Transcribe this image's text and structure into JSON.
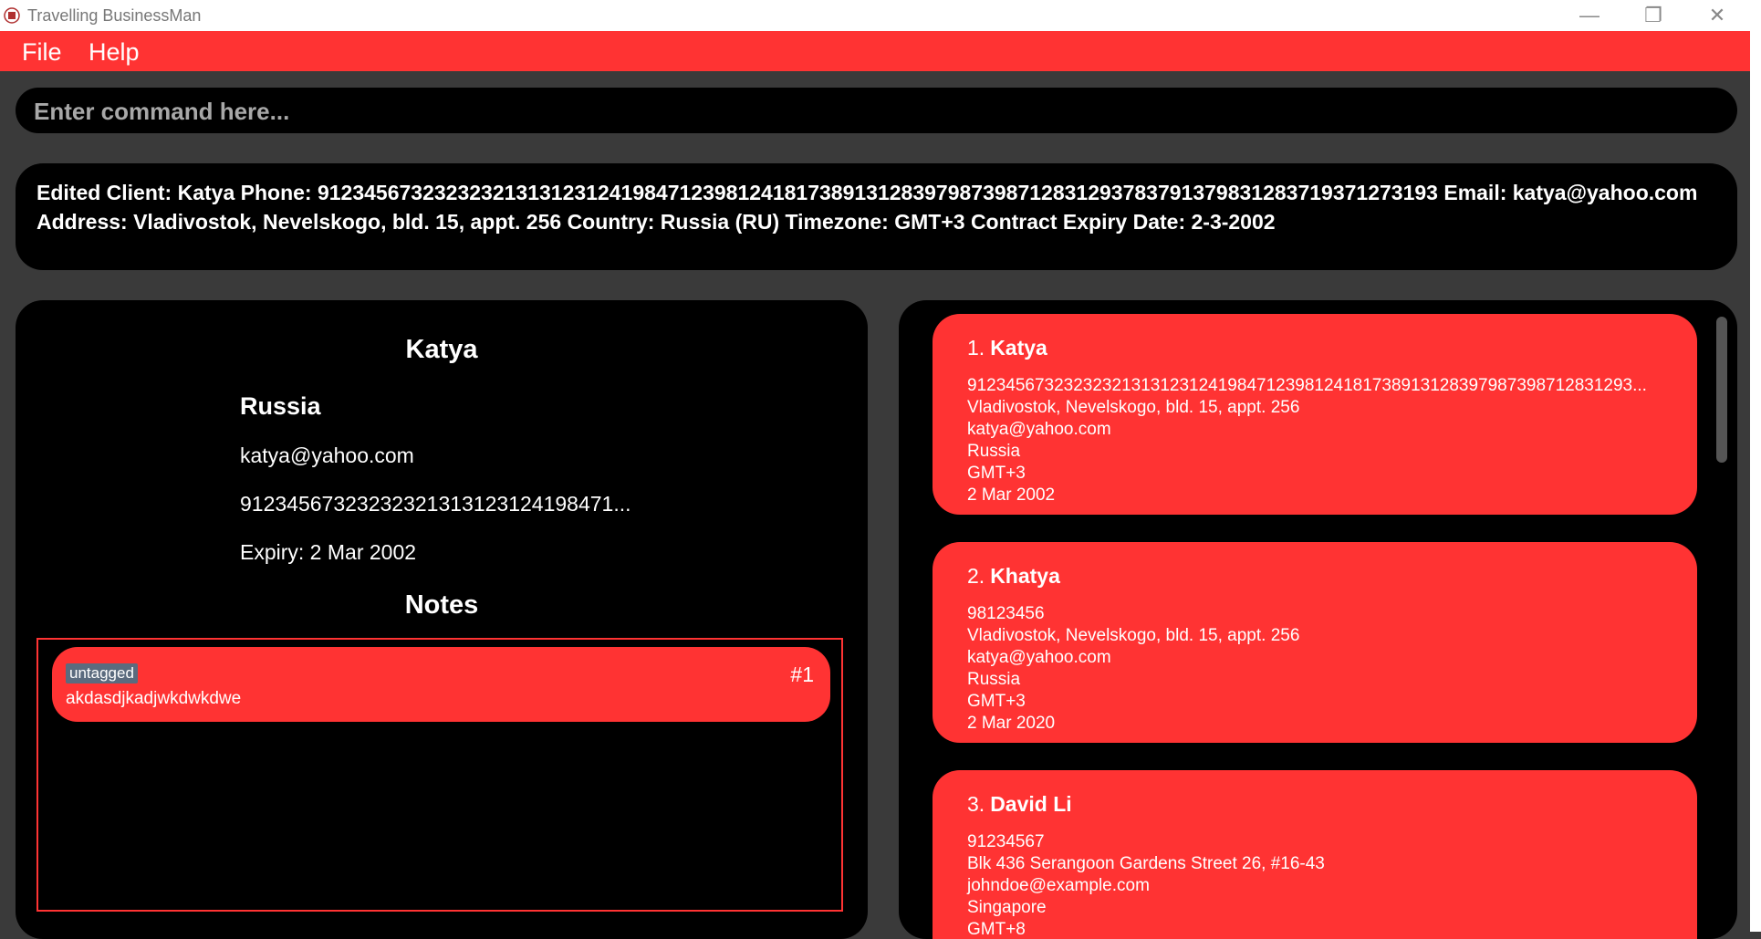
{
  "window": {
    "title": "Travelling BusinessMan",
    "minimize_glyph": "—",
    "maximize_glyph": "❐",
    "close_glyph": "✕"
  },
  "menu": {
    "file": "File",
    "help": "Help"
  },
  "command": {
    "placeholder": "Enter command here...",
    "value": ""
  },
  "result": {
    "text": "Edited Client: Katya Phone: 912345673232323213131231241984712398124181738913128397987398712831293783791379831283719371273193 Email: katya@yahoo.com Address: Vladivostok, Nevelskogo, bld. 15, appt. 256 Country: Russia (RU) Timezone: GMT+3 Contract Expiry Date: 2-3-2002"
  },
  "detail": {
    "name": "Katya",
    "country": "Russia",
    "email": "katya@yahoo.com",
    "phone": "91234567323232321313123124198471...",
    "expiry": "Expiry: 2 Mar 2002",
    "notes_title": "Notes",
    "notes": [
      {
        "tag": "untagged",
        "number": "#1",
        "text": "akdasdjkadjwkdwkdwe"
      }
    ]
  },
  "clients": [
    {
      "index": "1.",
      "name": "Katya",
      "phone": "912345673232323213131231241984712398124181738913128397987398712831293...",
      "address": "Vladivostok, Nevelskogo, bld. 15, appt. 256",
      "email": "katya@yahoo.com",
      "country": "Russia",
      "timezone": "GMT+3",
      "expiry": "2 Mar 2002"
    },
    {
      "index": "2.",
      "name": "Khatya",
      "phone": "98123456",
      "address": "Vladivostok, Nevelskogo, bld. 15, appt. 256",
      "email": "katya@yahoo.com",
      "country": "Russia",
      "timezone": "GMT+3",
      "expiry": "2 Mar 2020"
    },
    {
      "index": "3.",
      "name": "David Li",
      "phone": "91234567",
      "address": "Blk 436 Serangoon Gardens Street 26, #16-43",
      "email": "johndoe@example.com",
      "country": "Singapore",
      "timezone": "GMT+8",
      "expiry": ""
    }
  ],
  "colors": {
    "accent": "#ff3333",
    "panel": "#000000",
    "background": "#3a3a3a",
    "tag": "#5b6b7e"
  }
}
